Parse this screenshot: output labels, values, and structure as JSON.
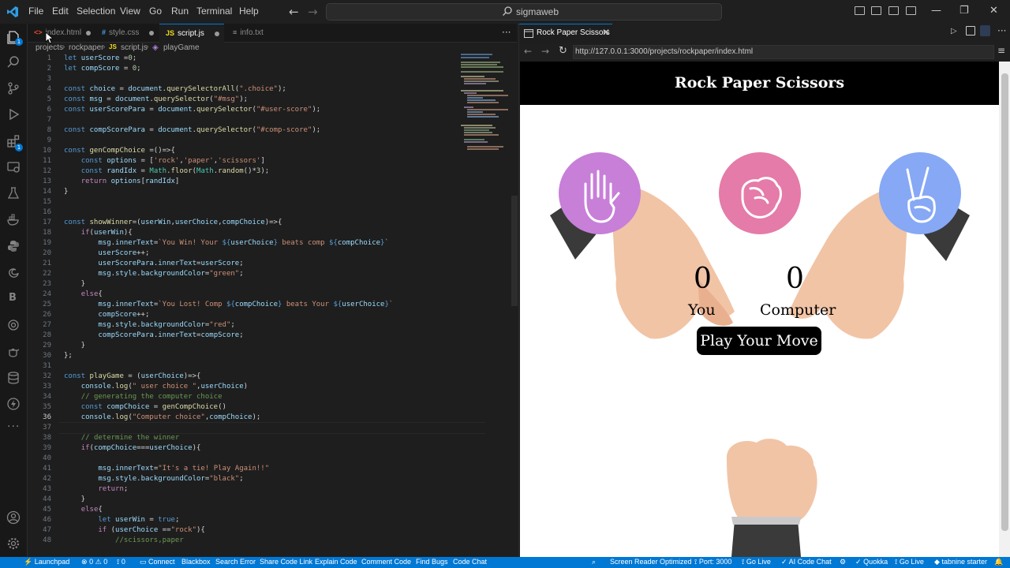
{
  "menu": [
    "File",
    "Edit",
    "Selection",
    "View",
    "Go",
    "Run",
    "Terminal",
    "Help"
  ],
  "command_center": {
    "label": "sigmaweb"
  },
  "tabs": [
    {
      "label": "index.html",
      "icon": "<>",
      "icon_color": "#e44d26"
    },
    {
      "label": "style.css",
      "icon": "#",
      "icon_color": "#42a5f5"
    },
    {
      "label": "script.js",
      "icon": "JS",
      "icon_color": "#f5de19"
    },
    {
      "label": "info.txt",
      "icon": "≡",
      "icon_color": "#9e9e9e"
    }
  ],
  "breadcrumb": [
    "projects",
    "rockpaper",
    "script.js",
    "playGame"
  ],
  "code": {
    "line_numbers": [
      "1",
      "2",
      "3",
      "4",
      "5",
      "6",
      "7",
      "8",
      "9",
      "10",
      "11",
      "12",
      "13",
      "14",
      "15",
      "16",
      "17",
      "18",
      "19",
      "20",
      "21",
      "22",
      "23",
      "24",
      "25",
      "26",
      "27",
      "28",
      "29",
      "30",
      "31",
      "32",
      "33",
      "34",
      "35",
      "36",
      "37",
      "38",
      "39",
      "40",
      "41",
      "42",
      "43",
      "44",
      "45",
      "46",
      "47",
      "48"
    ],
    "current_line": "36"
  },
  "preview": {
    "tab_label": "Rock Paper Scissors",
    "url": "http://127.0.0.1:3000/projects/rockpaper/index.html",
    "title": "Rock Paper Scissors",
    "user_score": "0",
    "comp_score": "0",
    "user_label": "You",
    "comp_label": "Computer",
    "message": "Play Your Move"
  },
  "status": {
    "launchpad": "Launchpad",
    "errors": "0",
    "warnings": "0",
    "ports": "0",
    "connect": "Connect",
    "blackbox": "Blackbox",
    "search_error": "Search Error",
    "share_code_link": "Share Code Link",
    "explain_code": "Explain Code",
    "comment_code": "Comment Code",
    "find_bugs": "Find Bugs",
    "code_chat": "Code Chat",
    "screen_reader": "Screen Reader Optimized",
    "port": "Port: 3000",
    "go_live": "Go Live",
    "ai_code_chat": "AI Code Chat",
    "quokka": "Quokka",
    "go_live_2": "Go Live",
    "tabnine": "tabnine starter"
  },
  "colors": {
    "accent": "#0078d4",
    "paper": "#c77fd8",
    "rock": "#e57ba8",
    "scissors": "#86a8f5"
  }
}
